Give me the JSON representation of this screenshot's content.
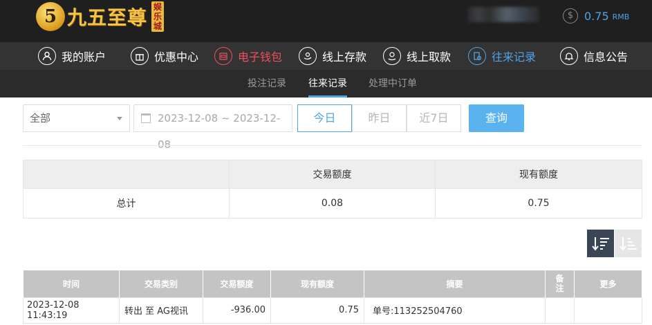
{
  "brand": {
    "badge": "5",
    "name": "九五至尊",
    "tag": "娱乐城"
  },
  "balance": {
    "amount": "0.75",
    "currency": "RMB"
  },
  "nav": [
    {
      "label": "我的账户",
      "icon": "user-icon",
      "state": "normal"
    },
    {
      "label": "优惠中心",
      "icon": "gift-icon",
      "state": "normal"
    },
    {
      "label": "电子钱包",
      "icon": "wallet-icon",
      "state": "highlight"
    },
    {
      "label": "线上存款",
      "icon": "deposit-icon",
      "state": "normal"
    },
    {
      "label": "线上取款",
      "icon": "withdraw-icon",
      "state": "normal"
    },
    {
      "label": "往来记录",
      "icon": "records-icon",
      "state": "active"
    },
    {
      "label": "信息公告",
      "icon": "bell-icon",
      "state": "normal"
    }
  ],
  "subnav": [
    {
      "label": "投注记录",
      "active": false
    },
    {
      "label": "往来记录",
      "active": true
    },
    {
      "label": "处理中订单",
      "active": false
    }
  ],
  "filter": {
    "type_value": "全部",
    "date_range": "2023-12-08 ~ 2023-12-08",
    "quick": [
      "今日",
      "昨日",
      "近7日"
    ],
    "quick_active": "今日",
    "search_label": "查询"
  },
  "summary": {
    "headers": [
      "",
      "交易额度",
      "现有额度"
    ],
    "row": [
      "总计",
      "0.08",
      "0.75"
    ]
  },
  "records": {
    "headers": [
      "时间",
      "交易类别",
      "交易额度",
      "现有额度",
      "摘要",
      "备注",
      "更多"
    ],
    "rows": [
      [
        "2023-12-08 11:43:19",
        "转出 至 AG视讯",
        "-936.00",
        "0.75",
        "单号:113252504760",
        "",
        ""
      ]
    ]
  },
  "colors": {
    "accent": "#4fa3e6",
    "highlight": "#ef4f5d",
    "header_bg": "#1f1f1f",
    "nav_bg": "#333333"
  }
}
